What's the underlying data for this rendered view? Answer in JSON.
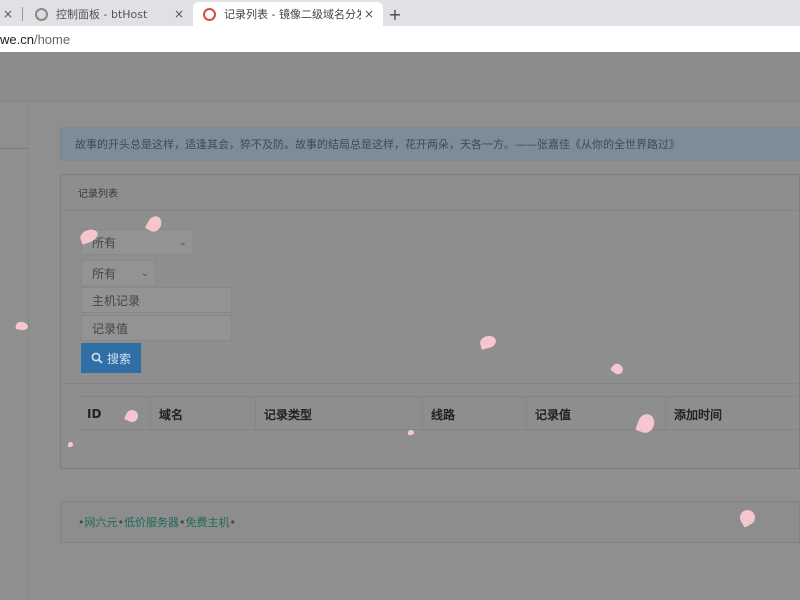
{
  "browser": {
    "tabs": [
      {
        "title": "",
        "close": "×"
      },
      {
        "title": "控制面板 - btHost",
        "close": "×"
      },
      {
        "title": "记录列表 - 镜像二级域名分发",
        "close": "×",
        "active": true
      }
    ],
    "new_tab": "+",
    "url_host": "we.cn",
    "url_path": "/home"
  },
  "notice": "故事的开头总是这样，适逢其会，猝不及防。故事的结局总是这样，花开两朵，天各一方。——张嘉佳《从你的全世界路过》",
  "panel": {
    "title": "记录列表",
    "filters": {
      "domain_select": "所有",
      "type_select": "所有",
      "host_placeholder": "主机记录",
      "value_placeholder": "记录值"
    },
    "search_label": "搜索"
  },
  "table": {
    "headers": [
      "ID",
      "域名",
      "记录类型",
      "线路",
      "记录值",
      "添加时间"
    ]
  },
  "footer": {
    "links": [
      "网六元",
      "低价服务器",
      "免费主机"
    ],
    "separator": "•"
  },
  "icons": {
    "search": "search-icon",
    "caret": "chevron-down-icon"
  },
  "colors": {
    "primary_button": "#2f6fa6",
    "notice_bg": "#7e8c98",
    "link": "#1f6a5a",
    "petal": "#f6c6cf"
  }
}
